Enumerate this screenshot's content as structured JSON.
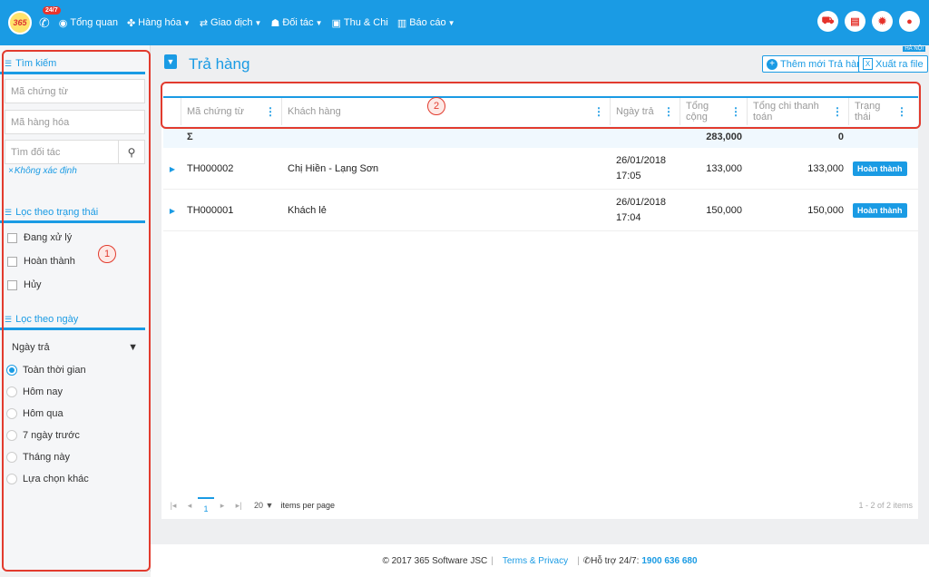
{
  "header": {
    "logo_text": "365",
    "badge": "24/7",
    "nav": [
      {
        "icon": "dashboard-icon",
        "label": "Tổng quan"
      },
      {
        "icon": "boxes-icon",
        "label": "Hàng hóa"
      },
      {
        "icon": "exchange-icon",
        "label": "Giao dịch"
      },
      {
        "icon": "users-icon",
        "label": "Đối tác"
      },
      {
        "icon": "money-icon",
        "label": "Thu & Chi"
      },
      {
        "icon": "chart-icon",
        "label": "Báo cáo"
      }
    ]
  },
  "sidebar": {
    "search": {
      "title": "Tìm kiếm",
      "doc_placeholder": "Mã chứng từ",
      "item_placeholder": "Mã hàng hóa",
      "partner_placeholder": "Tìm đối tác",
      "unknown_link": "Không xác định"
    },
    "status_filter": {
      "title": "Lọc theo trạng thái",
      "options": [
        "Đang xử lý",
        "Hoàn thành",
        "Hủy"
      ]
    },
    "date_filter": {
      "title": "Lọc theo ngày",
      "select_value": "Ngày trả",
      "options": [
        "Toàn thời gian",
        "Hôm nay",
        "Hôm qua",
        "7 ngày trước",
        "Tháng này",
        "Lựa chọn khác"
      ],
      "selected_index": 0
    }
  },
  "main": {
    "title": "Trả hàng",
    "location_tag": "HÀ NỘI",
    "add_button": "Thêm mới Trả hàng",
    "export_button": "Xuất ra file",
    "columns": [
      "Mã chứng từ",
      "Khách hàng",
      "Ngày trả",
      "Tổng cộng",
      "Tổng chi thanh toán",
      "Trạng thái"
    ],
    "summary": {
      "symbol": "Σ",
      "total": "283,000",
      "paid": "0"
    },
    "rows": [
      {
        "code": "TH000002",
        "customer": "Chị Hiền - Lạng Sơn",
        "date": "26/01/2018",
        "time": "17:05",
        "total": "133,000",
        "paid": "133,000",
        "status": "Hoàn thành"
      },
      {
        "code": "TH000001",
        "customer": "Khách lẻ",
        "date": "26/01/2018",
        "time": "17:04",
        "total": "150,000",
        "paid": "150,000",
        "status": "Hoàn thành"
      }
    ],
    "pager": {
      "current_page": "1",
      "page_size": "20",
      "per_page_label": "items per page",
      "range": "1 - 2 of 2 items"
    }
  },
  "footer": {
    "copyright": "© 2017 365 Software JSC",
    "terms": "Terms & Privacy",
    "support_label": "Hỗ trợ 24/7:",
    "phone": "1900 636 680"
  },
  "annotations": [
    "1",
    "2"
  ],
  "colors": {
    "primary": "#1a9be4",
    "annotation": "#e23b2e"
  }
}
